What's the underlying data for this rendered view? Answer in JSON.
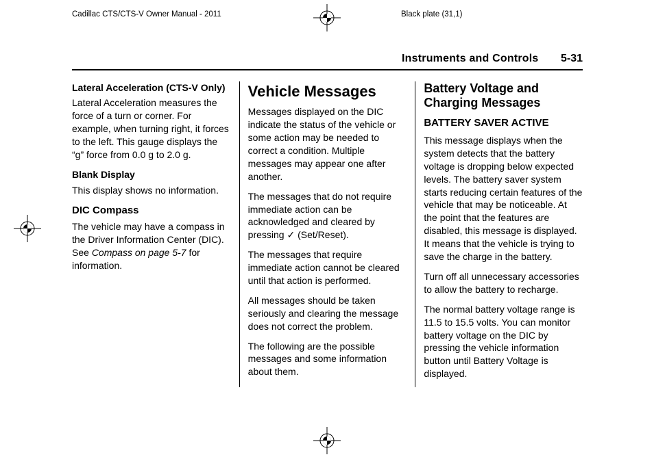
{
  "header": {
    "manual_title": "Cadillac CTS/CTS-V Owner Manual - 2011",
    "plate_note": "Black plate (31,1)"
  },
  "running_head": {
    "section": "Instruments and Controls",
    "page": "5-31"
  },
  "col1": {
    "lat_title": "Lateral Acceleration (CTS‑V Only)",
    "lat_body": "Lateral Acceleration measures the force of a turn or corner. For example, when turning right, it forces to the left. This gauge displays the “g” force from 0.0 g to 2.0 g.",
    "blank_title": "Blank Display",
    "blank_body": "This display shows no information.",
    "dic_title": "DIC Compass",
    "dic_body_pre": "The vehicle may have a compass in the Driver Information Center (DIC). See ",
    "dic_ref": "Compass on page 5‑7",
    "dic_body_post": " for information."
  },
  "col2": {
    "title": "Vehicle Messages",
    "p1": "Messages displayed on the DIC indicate the status of the vehicle or some action may be needed to correct a condition. Multiple messages may appear one after another.",
    "p2_pre": "The messages that do not require immediate action can be acknowledged and cleared by pressing ",
    "p2_icon": "✓",
    "p2_post": " (Set/Reset).",
    "p3": "The messages that require immediate action cannot be cleared until that action is performed.",
    "p4": "All messages should be taken seriously and clearing the message does not correct the problem.",
    "p5": "The following are the possible messages and some information about them."
  },
  "col3": {
    "title": "Battery Voltage and Charging Messages",
    "bsa_title": "BATTERY SAVER ACTIVE",
    "p1": "This message displays when the system detects that the battery voltage is dropping below expected levels. The battery saver system starts reducing certain features of the vehicle that may be noticeable. At the point that the features are disabled, this message is displayed. It means that the vehicle is trying to save the charge in the battery.",
    "p2": "Turn off all unnecessary accessories to allow the battery to recharge.",
    "p3": "The normal battery voltage range is 11.5 to 15.5 volts. You can monitor battery voltage on the DIC by pressing the vehicle information button until Battery Voltage is displayed."
  }
}
